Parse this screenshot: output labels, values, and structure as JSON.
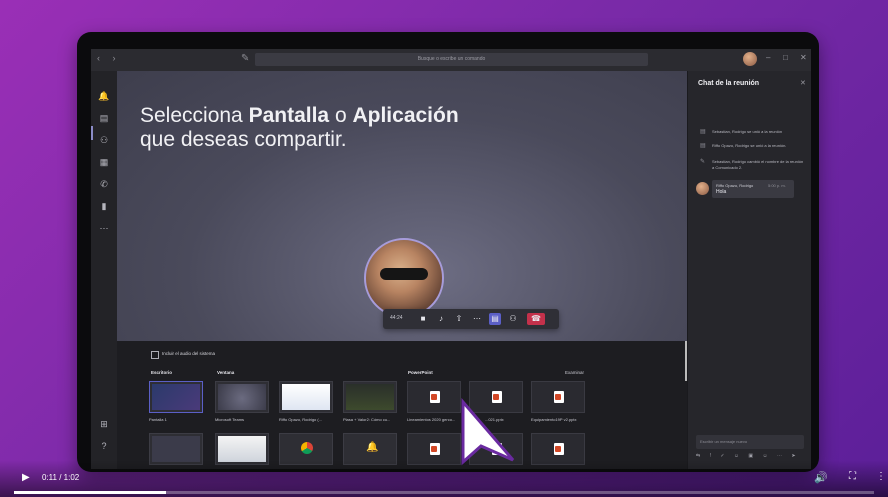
{
  "app": {
    "search_placeholder": "Busque o escribe un comando",
    "nav_arrows": "‹ ›",
    "window_controls": [
      "–",
      "□",
      "✕"
    ]
  },
  "share": {
    "headline_line1_a": "Selecciona ",
    "headline_line1_b": "Pantalla",
    "headline_line1_c": " o ",
    "headline_line1_d": "Aplicación",
    "headline_line2": "que deseas compartir.",
    "include_audio": "Incluir el audio del sistema",
    "sections": {
      "desktop": "Escritorio",
      "window": "Ventana",
      "powerpoint": "PowerPoint",
      "browse": "Examinar"
    },
    "tiles": [
      {
        "label": "Pantalla 1"
      },
      {
        "label": "Microsoft Teams"
      },
      {
        "label": "Riffo Opazo, Rodrigo (..."
      },
      {
        "label": "Plasa + Valor2: Cómo cu..."
      },
      {
        "label": "Lineamientos 2020 gerco..."
      },
      {
        "label": "...021.pptx"
      },
      {
        "label": "Equipamiento19P v2.pptx"
      }
    ]
  },
  "call": {
    "timer": "44:24",
    "buttons": [
      "camera-icon",
      "mic-icon",
      "share-icon",
      "more-icon",
      "chat-icon",
      "participants-icon",
      "hangup-icon"
    ]
  },
  "chat": {
    "title": "Chat de la reunión",
    "close": "✕",
    "events": [
      {
        "icon": "meeting-icon",
        "text": "Sebastian, Rodrigo se unió a la reunión"
      },
      {
        "icon": "meeting-icon",
        "text": "Riffo Opazo, Rodrigo se unió a la reunión."
      },
      {
        "icon": "pencil-icon",
        "text": "Sebastian, Rodrigo cambió el nombre de la reunión a Comunicado 2."
      }
    ],
    "message": {
      "author": "Riffo Opazo, Rodrigo",
      "time": "5:00 p. m.",
      "text": "Hola"
    },
    "compose_placeholder": "Escribir un mensaje nuevo",
    "compose_tools": "⇆ ! ✓ ☺ ▣ ☺ ⋯ ➤"
  },
  "player": {
    "time": "0:11 / 1:02",
    "progress": 0.177
  },
  "colors": {
    "background": "#8a2bb0",
    "accent": "#5b5fc7",
    "hangup": "#c4314b"
  }
}
